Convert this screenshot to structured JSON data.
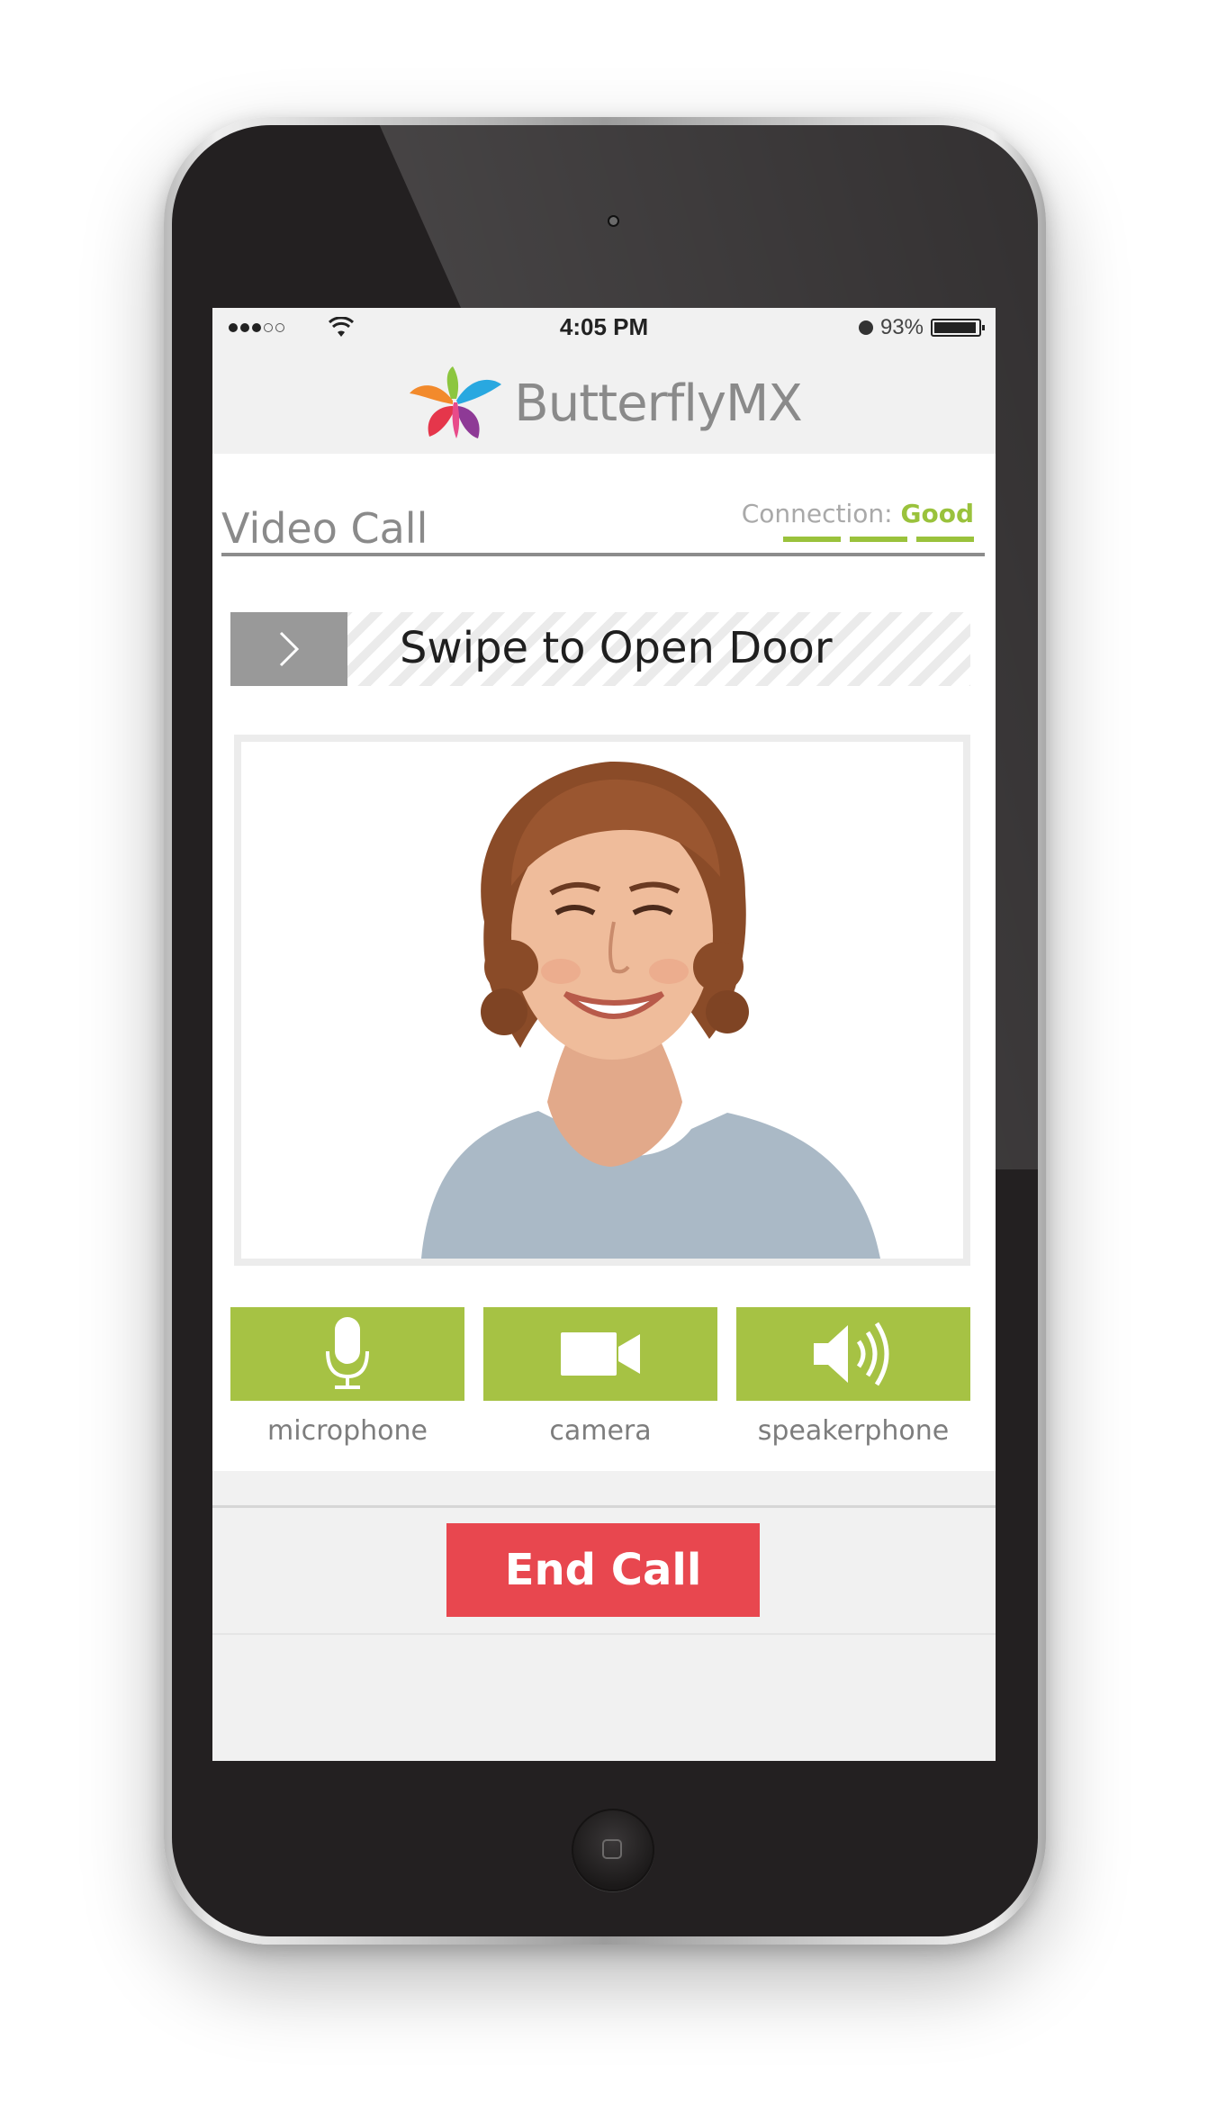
{
  "status_bar": {
    "time": "4:05 PM",
    "battery": "93%"
  },
  "header": {
    "brand": "ButterflyMX"
  },
  "page": {
    "title": "Video Call",
    "connection_label": "Connection:",
    "connection_status": "Good",
    "connection_bars": 3
  },
  "swipe": {
    "label": "Swipe to Open Door"
  },
  "controls": {
    "microphone_label": "microphone",
    "camera_label": "camera",
    "speakerphone_label": "speakerphone"
  },
  "footer": {
    "end_call_label": "End Call"
  },
  "colors": {
    "accent_green": "#a6c244",
    "end_call_red": "#e8474f",
    "connection_good": "#9ac23c"
  }
}
